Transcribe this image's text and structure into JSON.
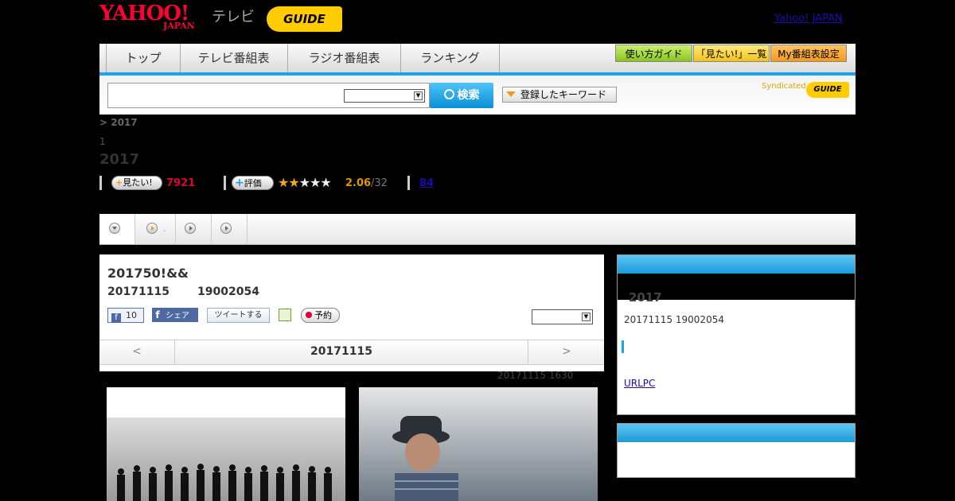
{
  "header": {
    "yahoo_logo": "YAHOO!",
    "yahoo_japan": "JAPAN",
    "tv_label": "テレビ",
    "gguide_logo": "GUIDE",
    "yahoo_japan_link": "Yahoo! JAPAN"
  },
  "nav": {
    "tabs": [
      {
        "label": "トップ"
      },
      {
        "label": "テレビ番組表"
      },
      {
        "label": "ラジオ番組表"
      },
      {
        "label": "ランキング"
      }
    ],
    "guide_btn": "使い方ガイド",
    "mitai_list_btn": "「見たい!」一覧",
    "my_schedule_btn": "My番組表設定"
  },
  "search": {
    "button_label": "検索",
    "keywords_label": "登録したキーワード",
    "syndicated": "Syndicated",
    "syndicated_logo": "GUIDE"
  },
  "program": {
    "breadcrumb": "> 2017",
    "page_num": "1",
    "title": "2017",
    "mitai_label": "見たい!",
    "mitai_count": "7921",
    "rate_label": "評価",
    "stars": "★★★★★",
    "rating": 2.06,
    "rating_text": "2.06",
    "rating_total": "/32",
    "count_link": "84"
  },
  "detail": {
    "title": "201750!&&",
    "date": "20171115",
    "time": "19002054",
    "fb_count": "10",
    "fb_share": "シェア",
    "tweet": "ツイートする",
    "yoyaku": "予約",
    "prev": "<",
    "current_date": "20171115",
    "next": ">",
    "updated": "20171115  1630"
  },
  "sidebar": {
    "title": "2017",
    "time": "20171115  19002054",
    "link": "URLPC"
  },
  "colors": {
    "accent": "#1aa3e8",
    "yahoo_red": "#ff0033",
    "gguide_yellow": "#ffcc00",
    "mitai_red": "#e0003a",
    "rating_orange": "#e09a00"
  }
}
